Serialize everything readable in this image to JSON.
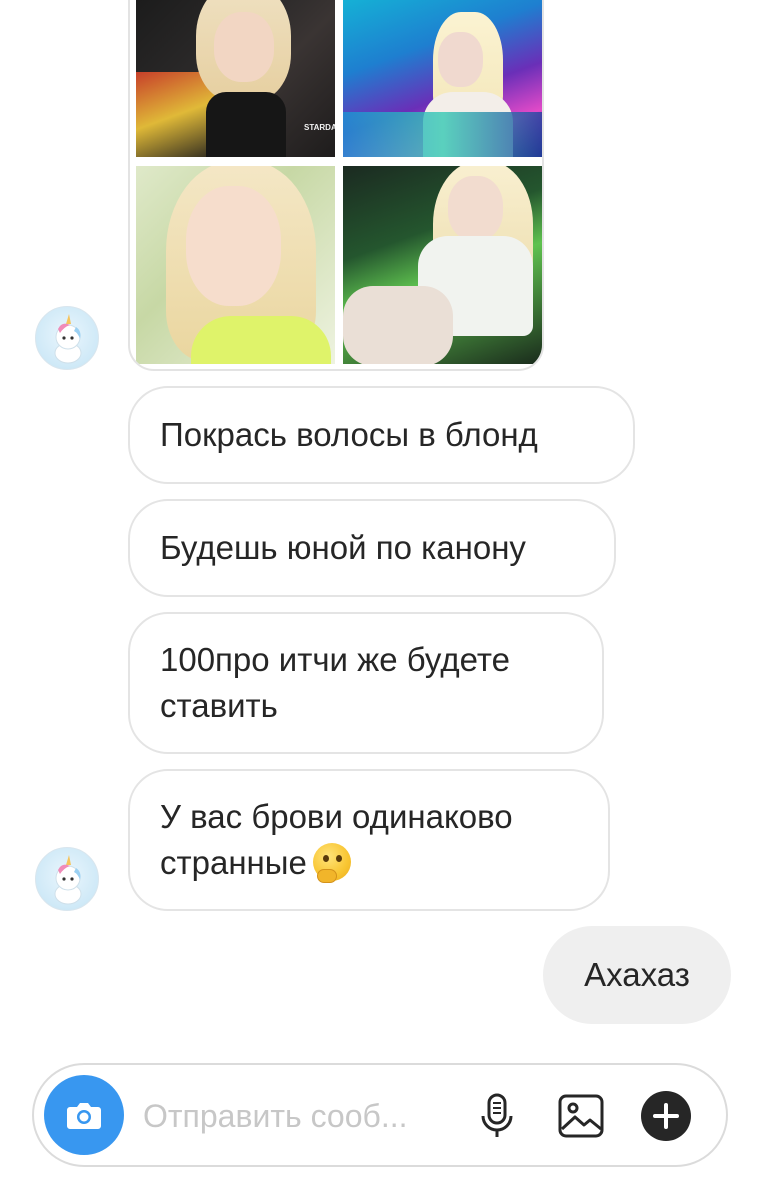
{
  "thread": {
    "messages": [
      {
        "from": "other",
        "text": "Покрась волосы в блонд"
      },
      {
        "from": "other",
        "text": "Будешь юной по канону"
      },
      {
        "from": "other",
        "text": "100про итчи же будете\nставить"
      },
      {
        "from": "other",
        "text": "У вас брови одинаково\nстранные",
        "emoji": "thinking-face"
      },
      {
        "from": "me",
        "text": "Ахахаз"
      }
    ],
    "photo_caption": "STARDAIL"
  },
  "composer": {
    "placeholder": "Отправить сооб..."
  },
  "colors": {
    "accent": "#3897f0",
    "outgoing_bubble": "#efefef",
    "incoming_border": "#e4e4e4",
    "placeholder": "#c7c7c7"
  },
  "icons": [
    "camera-icon",
    "microphone-icon",
    "gallery-icon",
    "plus-icon",
    "unicorn-avatar"
  ]
}
